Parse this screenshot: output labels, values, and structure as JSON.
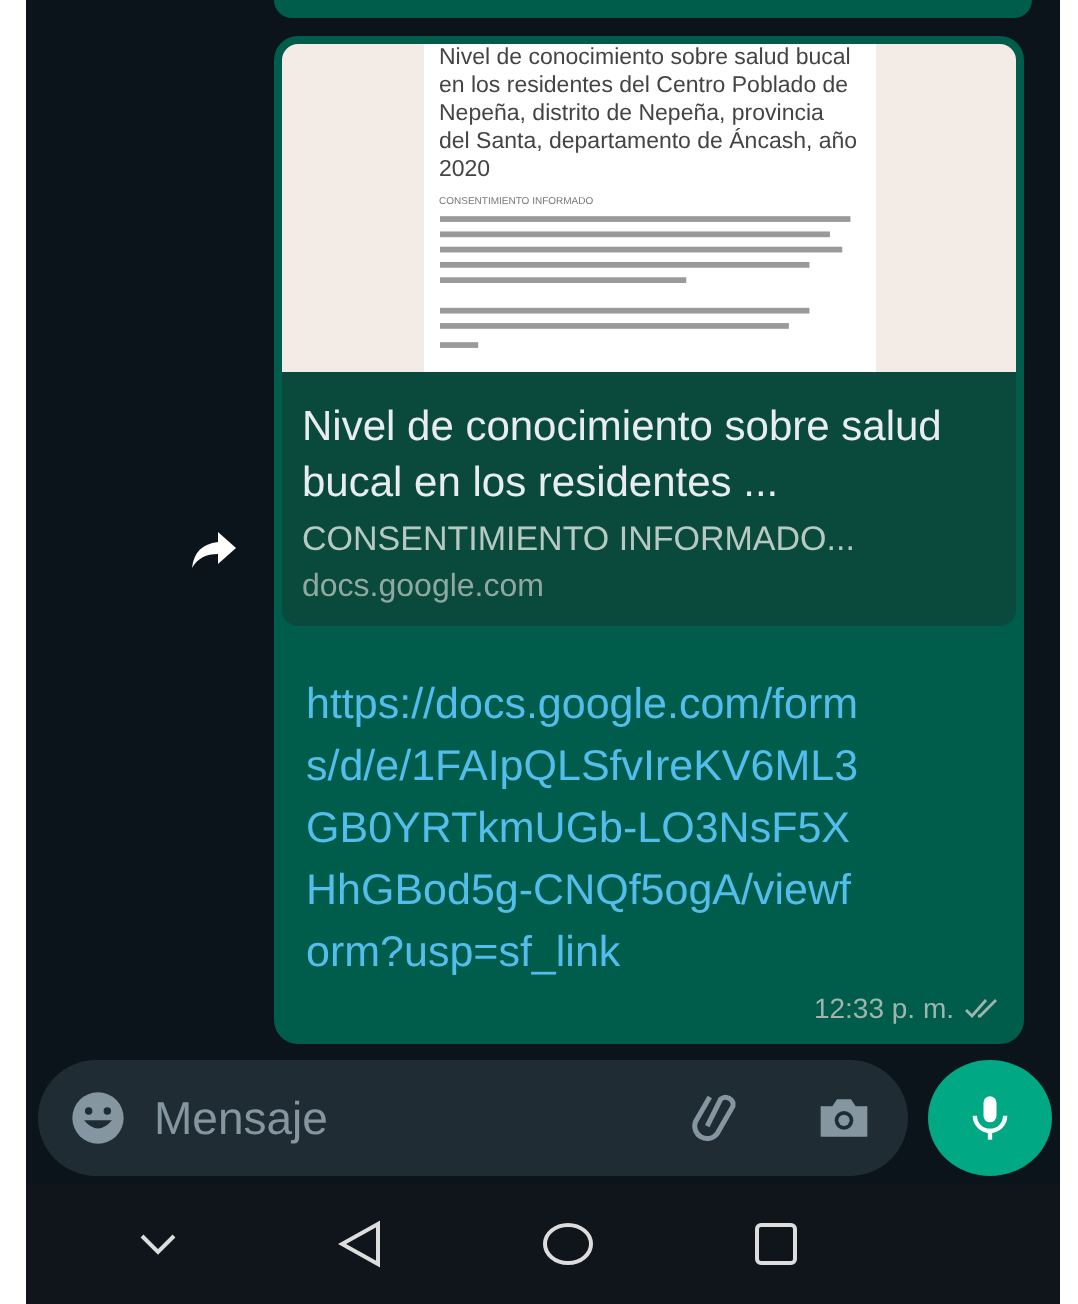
{
  "message": {
    "preview": {
      "document": {
        "title": "Nivel de conocimiento sobre salud bucal en los residentes del Centro Poblado de Nepeña, distrito de Nepeña, provincia del Santa, departamento de Áncash, año 2020",
        "section": "CONSENTIMIENTO INFORMADO"
      },
      "title": "Nivel de conocimiento sobre salud bucal en los residentes ...",
      "description": "CONSENTIMIENTO INFORMADO...",
      "domain": "docs.google.com"
    },
    "link": "https://docs.google.com/forms/d/e/1FAIpQLSfvIreKV6ML3GB0YRTkmUGb-LO3NsF5XHhGBod5g-CNQf5ogA/viewform?usp=sf_link",
    "time": "12:33 p. m."
  },
  "composer": {
    "placeholder": "Mensaje"
  }
}
